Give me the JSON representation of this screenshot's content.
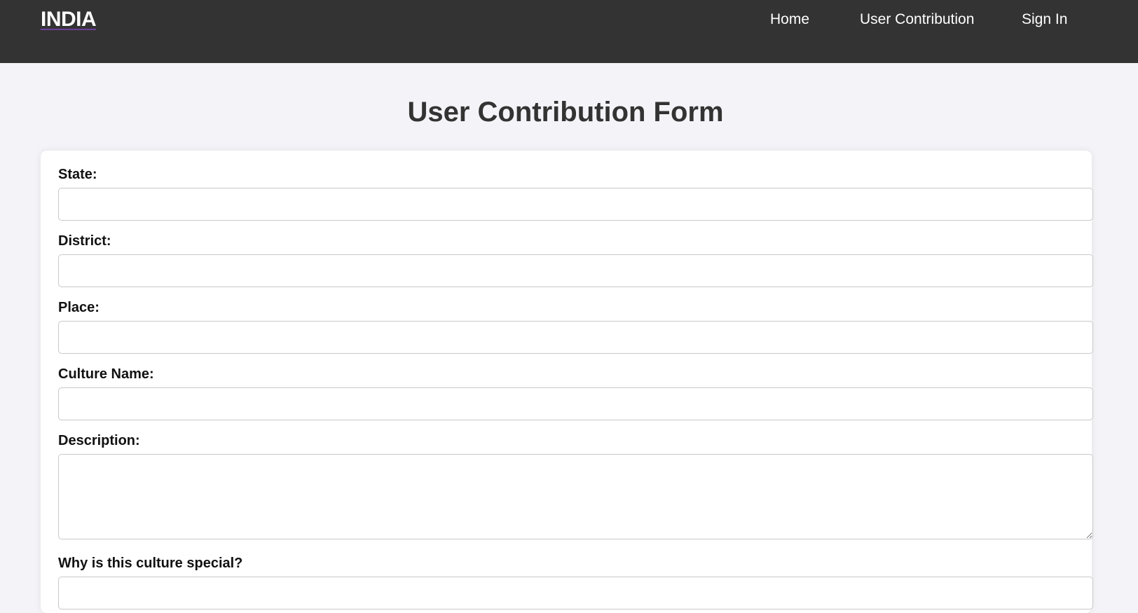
{
  "navbar": {
    "brand": "INDIA",
    "links": [
      "Home",
      "User Contribution",
      "Sign In"
    ]
  },
  "page": {
    "title": "User Contribution Form"
  },
  "form": {
    "fields": [
      {
        "label": "State:",
        "value": ""
      },
      {
        "label": "District:",
        "value": ""
      },
      {
        "label": "Place:",
        "value": ""
      },
      {
        "label": "Culture Name:",
        "value": ""
      },
      {
        "label": "Description:",
        "value": ""
      },
      {
        "label": "Why is this culture special?",
        "value": ""
      }
    ]
  },
  "colors": {
    "navbar_bg": "#333333",
    "page_bg": "#f4f4f8",
    "brand_underline": "#6a3fa0"
  }
}
